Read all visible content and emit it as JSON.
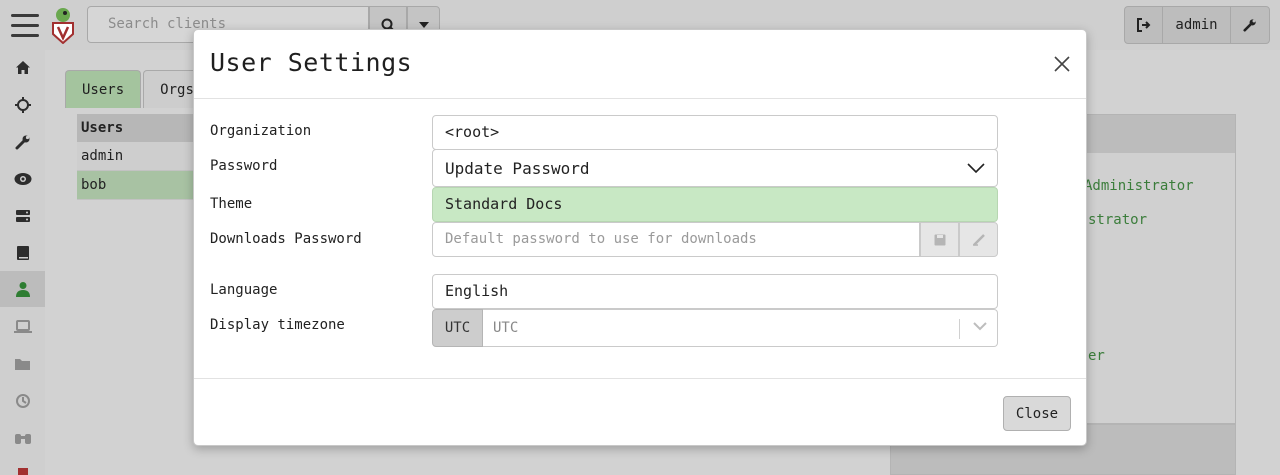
{
  "topbar": {
    "search_placeholder": "Search clients",
    "username": "admin"
  },
  "sidebar": {
    "icons": [
      "home-icon",
      "crosshair-icon",
      "wrench-icon",
      "eye-icon",
      "server-icon",
      "book-icon",
      "user-icon",
      "laptop-icon",
      "folder-icon",
      "history-icon",
      "binoculars-icon",
      "logo-icon"
    ]
  },
  "background": {
    "tabs": [
      "Users",
      "Orgs"
    ],
    "table_header": "Users",
    "rows": [
      "admin",
      "bob"
    ],
    "right_panel_lines": [
      "Administrator",
      "strator",
      "er"
    ]
  },
  "modal": {
    "title": "User Settings",
    "fields": {
      "organization_label": "Organization",
      "organization_value": "<root>",
      "password_label": "Password",
      "password_value": "Update Password",
      "theme_label": "Theme",
      "theme_value": "Standard Docs",
      "downloads_label": "Downloads Password",
      "downloads_placeholder": "Default password to use for downloads",
      "language_label": "Language",
      "language_value": "English",
      "timezone_label": "Display timezone",
      "timezone_addon": "UTC",
      "timezone_value": "UTC"
    },
    "close_button": "Close"
  },
  "colors": {
    "accent_green": "#2e7d32",
    "theme_option_bg": "#c8e8c4",
    "active_tab": "#a4c49e"
  }
}
